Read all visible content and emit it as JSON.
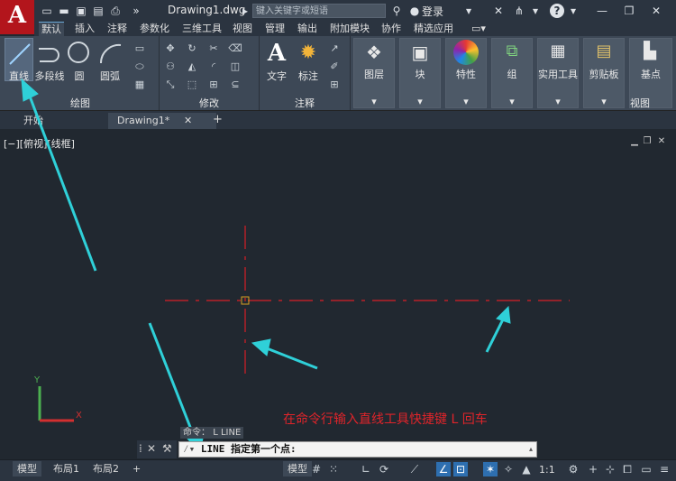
{
  "app": {
    "logo_letter": "A",
    "doc_title": "Drawing1.dwg",
    "search_placeholder": "键入关键字或短语",
    "login": "登录"
  },
  "ribbon_tabs": [
    "默认",
    "插入",
    "注释",
    "参数化",
    "三维工具",
    "视图",
    "管理",
    "输出",
    "附加模块",
    "协作",
    "精选应用"
  ],
  "draw_panel": {
    "line": "直线",
    "polyline": "多段线",
    "circle": "圆",
    "arc": "圆弧",
    "title": "绘图"
  },
  "modify_panel": {
    "title": "修改"
  },
  "annotation_panel": {
    "text": "文字",
    "dimension": "标注",
    "title": "注释"
  },
  "groups": {
    "layers": "图层",
    "block": "块",
    "properties": "特性",
    "group": "组",
    "utilities": "实用工具",
    "clipboard": "剪贴板",
    "base": "基点",
    "view": "视图"
  },
  "file_tabs": {
    "start": "开始",
    "drawing": "Drawing1*"
  },
  "viewport_label": "[−][俯视][线框]",
  "command": {
    "history_prefix": "命令：",
    "history": "L LINE",
    "current": "LINE 指定第一个点:"
  },
  "hint_text": "在命令行输入直线工具快捷键 L 回车",
  "layout_tabs": [
    "模型",
    "布局1",
    "布局2"
  ],
  "status": {
    "model": "模型",
    "scale": "1:1"
  },
  "colors": {
    "crosshair": "#d81f26",
    "arrow": "#2fd0d8",
    "hint": "#e0242a",
    "accent": "#2e6fb0"
  }
}
